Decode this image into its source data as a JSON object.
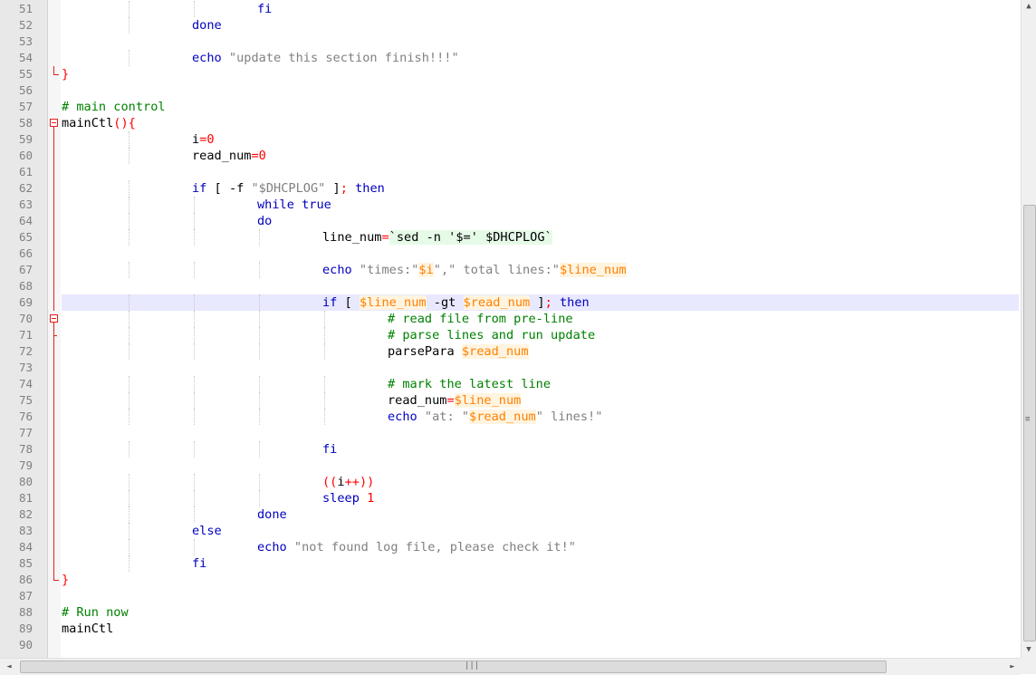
{
  "lines": [
    {
      "n": "51",
      "indent": 3,
      "tokens": [
        {
          "t": "fi",
          "c": "kw"
        }
      ]
    },
    {
      "n": "52",
      "indent": 2,
      "tokens": [
        {
          "t": "done",
          "c": "kw"
        }
      ]
    },
    {
      "n": "53",
      "indent": 0,
      "tokens": []
    },
    {
      "n": "54",
      "indent": 2,
      "tokens": [
        {
          "t": "echo",
          "c": "kw"
        },
        {
          "t": " \"update this section finish!!!\"",
          "c": "str"
        }
      ]
    },
    {
      "n": "55",
      "indent": 0,
      "tokens": [
        {
          "t": "}",
          "c": "op"
        }
      ]
    },
    {
      "n": "56",
      "indent": 0,
      "tokens": []
    },
    {
      "n": "57",
      "indent": 0,
      "tokens": [
        {
          "t": "# main control",
          "c": "cmt"
        }
      ]
    },
    {
      "n": "58",
      "indent": 0,
      "tokens": [
        {
          "t": "mainCtl",
          "c": "plain"
        },
        {
          "t": "(){",
          "c": "op"
        }
      ]
    },
    {
      "n": "59",
      "indent": 2,
      "tokens": [
        {
          "t": "i",
          "c": "plain"
        },
        {
          "t": "=",
          "c": "op"
        },
        {
          "t": "0",
          "c": "num"
        }
      ]
    },
    {
      "n": "60",
      "indent": 2,
      "tokens": [
        {
          "t": "read_num",
          "c": "plain"
        },
        {
          "t": "=",
          "c": "op"
        },
        {
          "t": "0",
          "c": "num"
        }
      ]
    },
    {
      "n": "61",
      "indent": 0,
      "tokens": []
    },
    {
      "n": "62",
      "indent": 2,
      "tokens": [
        {
          "t": "if",
          "c": "kw"
        },
        {
          "t": " [ ",
          "c": "plain"
        },
        {
          "t": "-f",
          "c": "plain"
        },
        {
          "t": " \"$DHCPLOG\"",
          "c": "str"
        },
        {
          "t": " ]",
          "c": "plain"
        },
        {
          "t": ";",
          "c": "op"
        },
        {
          "t": " then",
          "c": "kw"
        }
      ]
    },
    {
      "n": "63",
      "indent": 3,
      "tokens": [
        {
          "t": "while true",
          "c": "kw"
        }
      ]
    },
    {
      "n": "64",
      "indent": 3,
      "tokens": [
        {
          "t": "do",
          "c": "kw"
        }
      ]
    },
    {
      "n": "65",
      "indent": 4,
      "tokens": [
        {
          "t": "line_num",
          "c": "plain"
        },
        {
          "t": "=",
          "c": "op"
        },
        {
          "t": "`sed -n '$=' $DHCPLOG`",
          "c": "plain bt"
        }
      ]
    },
    {
      "n": "66",
      "indent": 0,
      "tokens": []
    },
    {
      "n": "67",
      "indent": 4,
      "tokens": [
        {
          "t": "echo",
          "c": "kw"
        },
        {
          "t": " \"times:\"",
          "c": "str"
        },
        {
          "t": "$i",
          "c": "var"
        },
        {
          "t": "\",\"",
          "c": "str"
        },
        {
          "t": " total lines:\"",
          "c": "str"
        },
        {
          "t": "$line_num",
          "c": "var"
        }
      ]
    },
    {
      "n": "68",
      "indent": 0,
      "tokens": []
    },
    {
      "n": "69",
      "indent": 4,
      "current": true,
      "tokens": [
        {
          "t": "if",
          "c": "kw"
        },
        {
          "t": " [ ",
          "c": "plain"
        },
        {
          "t": "$line_num",
          "c": "var"
        },
        {
          "t": " -gt ",
          "c": "plain"
        },
        {
          "t": "$read_num",
          "c": "var"
        },
        {
          "t": " ]",
          "c": "plain"
        },
        {
          "t": ";",
          "c": "op"
        },
        {
          "t": " then",
          "c": "kw"
        }
      ]
    },
    {
      "n": "70",
      "indent": 5,
      "tokens": [
        {
          "t": "# read file from pre-line",
          "c": "cmt"
        }
      ]
    },
    {
      "n": "71",
      "indent": 5,
      "tokens": [
        {
          "t": "# parse lines and run update",
          "c": "cmt"
        }
      ]
    },
    {
      "n": "72",
      "indent": 5,
      "tokens": [
        {
          "t": "parsePara ",
          "c": "plain"
        },
        {
          "t": "$read_num",
          "c": "var"
        }
      ]
    },
    {
      "n": "73",
      "indent": 0,
      "tokens": []
    },
    {
      "n": "74",
      "indent": 5,
      "tokens": [
        {
          "t": "# mark the latest line",
          "c": "cmt"
        }
      ]
    },
    {
      "n": "75",
      "indent": 5,
      "tokens": [
        {
          "t": "read_num",
          "c": "plain"
        },
        {
          "t": "=",
          "c": "op"
        },
        {
          "t": "$line_num",
          "c": "var"
        }
      ]
    },
    {
      "n": "76",
      "indent": 5,
      "tokens": [
        {
          "t": "echo",
          "c": "kw"
        },
        {
          "t": " \"at: \"",
          "c": "str"
        },
        {
          "t": "$read_num",
          "c": "var"
        },
        {
          "t": "\" lines!\"",
          "c": "str"
        }
      ]
    },
    {
      "n": "77",
      "indent": 0,
      "tokens": []
    },
    {
      "n": "78",
      "indent": 4,
      "tokens": [
        {
          "t": "fi",
          "c": "kw"
        }
      ]
    },
    {
      "n": "79",
      "indent": 0,
      "tokens": []
    },
    {
      "n": "80",
      "indent": 4,
      "tokens": [
        {
          "t": "((",
          "c": "op"
        },
        {
          "t": "i",
          "c": "plain"
        },
        {
          "t": "++",
          "c": "op"
        },
        {
          "t": "))",
          "c": "op"
        }
      ]
    },
    {
      "n": "81",
      "indent": 4,
      "tokens": [
        {
          "t": "sleep",
          "c": "kw"
        },
        {
          "t": " ",
          "c": "plain"
        },
        {
          "t": "1",
          "c": "num"
        }
      ]
    },
    {
      "n": "82",
      "indent": 3,
      "tokens": [
        {
          "t": "done",
          "c": "kw"
        }
      ]
    },
    {
      "n": "83",
      "indent": 2,
      "tokens": [
        {
          "t": "else",
          "c": "kw"
        }
      ]
    },
    {
      "n": "84",
      "indent": 3,
      "tokens": [
        {
          "t": "echo",
          "c": "kw"
        },
        {
          "t": " \"not found log file, please check it!\"",
          "c": "str"
        }
      ]
    },
    {
      "n": "85",
      "indent": 2,
      "tokens": [
        {
          "t": "fi",
          "c": "kw"
        }
      ]
    },
    {
      "n": "86",
      "indent": 0,
      "tokens": [
        {
          "t": "}",
          "c": "op"
        }
      ]
    },
    {
      "n": "87",
      "indent": 0,
      "tokens": []
    },
    {
      "n": "88",
      "indent": 0,
      "tokens": [
        {
          "t": "# Run now",
          "c": "cmt"
        }
      ]
    },
    {
      "n": "89",
      "indent": 0,
      "tokens": [
        {
          "t": "mainCtl",
          "c": "plain"
        }
      ]
    },
    {
      "n": "90",
      "indent": 0,
      "tokens": []
    }
  ],
  "scrollbar": {
    "up_arrow": "▲",
    "down_arrow": "▼",
    "left_arrow": "◄",
    "right_arrow": "►",
    "v_grip": "≡",
    "h_grip": "|||"
  },
  "colors": {
    "keyword": "#0000c0",
    "string": "#808080",
    "variable": "#ff8000",
    "comment": "#008000",
    "number": "#ff0000",
    "current_line": "#e8e8ff",
    "fold_marker": "#e02020"
  }
}
